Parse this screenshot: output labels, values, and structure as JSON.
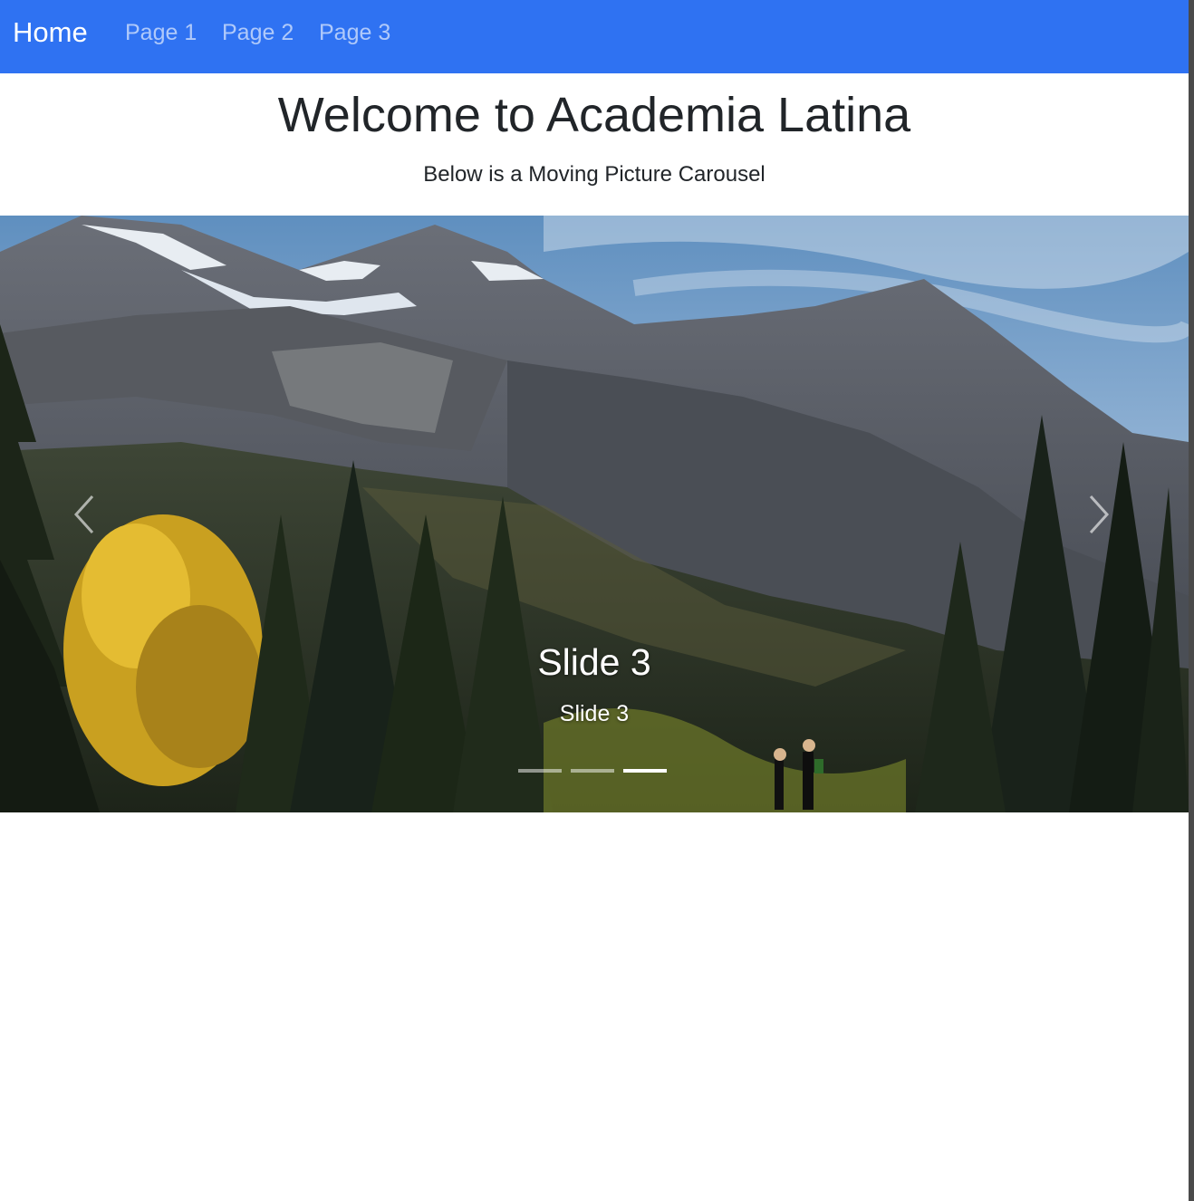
{
  "navbar": {
    "brand": "Home",
    "links": [
      "Page 1",
      "Page 2",
      "Page 3"
    ],
    "background_color": "#2f72f2"
  },
  "header": {
    "title": "Welcome to Academia Latina",
    "subtitle": "Below is a Moving Picture Carousel"
  },
  "carousel": {
    "active_slide": 3,
    "slide_count": 3,
    "caption_title": "Slide 3",
    "caption_text": "Slide 3",
    "prev_icon": "chevron-left-icon",
    "next_icon": "chevron-right-icon"
  }
}
